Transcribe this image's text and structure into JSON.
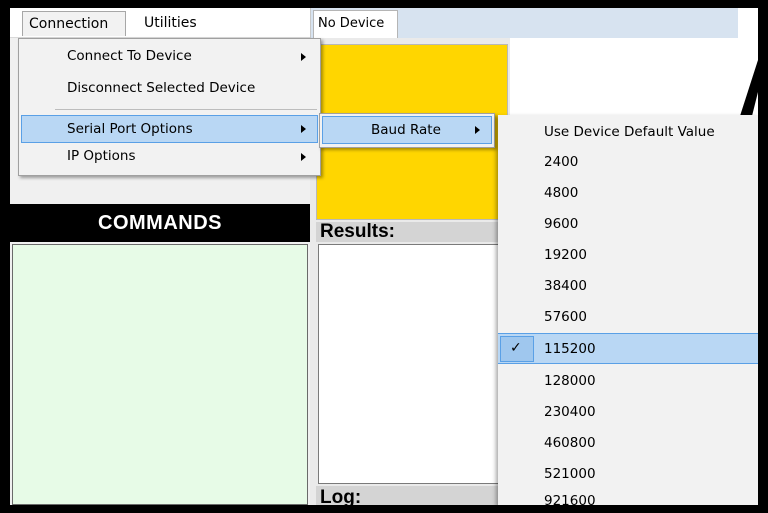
{
  "menubar": {
    "connection_label": "Connection",
    "utilities_label": "Utilities"
  },
  "tab": {
    "device_label": "No Device"
  },
  "panels": {
    "commands_title": "COMMANDS",
    "results_label": "Results:",
    "log_label": "Log:"
  },
  "connection_menu": {
    "items": [
      {
        "label": "Connect To Device",
        "submenu": true
      },
      {
        "label": "Disconnect Selected Device",
        "submenu": false
      },
      {
        "label": "Serial Port Options",
        "submenu": true,
        "highlighted": true
      },
      {
        "label": "IP Options",
        "submenu": true
      }
    ]
  },
  "serial_menu": {
    "baud_rate_label": "Baud Rate"
  },
  "baud_menu": {
    "items": [
      {
        "label": "Use Device Default Value"
      },
      {
        "label": "2400"
      },
      {
        "label": "4800"
      },
      {
        "label": "9600"
      },
      {
        "label": "19200"
      },
      {
        "label": "38400"
      },
      {
        "label": "57600"
      },
      {
        "label": "115200",
        "checked": true
      },
      {
        "label": "128000"
      },
      {
        "label": "230400"
      },
      {
        "label": "460800"
      },
      {
        "label": "521000"
      },
      {
        "label": "921600"
      }
    ],
    "check_mark": "✓"
  },
  "colors": {
    "highlight": "#b9d7f4",
    "highlight_border": "#5aa0e6",
    "yellow": "#ffd600",
    "commands_bg": "#e7fbe7"
  }
}
